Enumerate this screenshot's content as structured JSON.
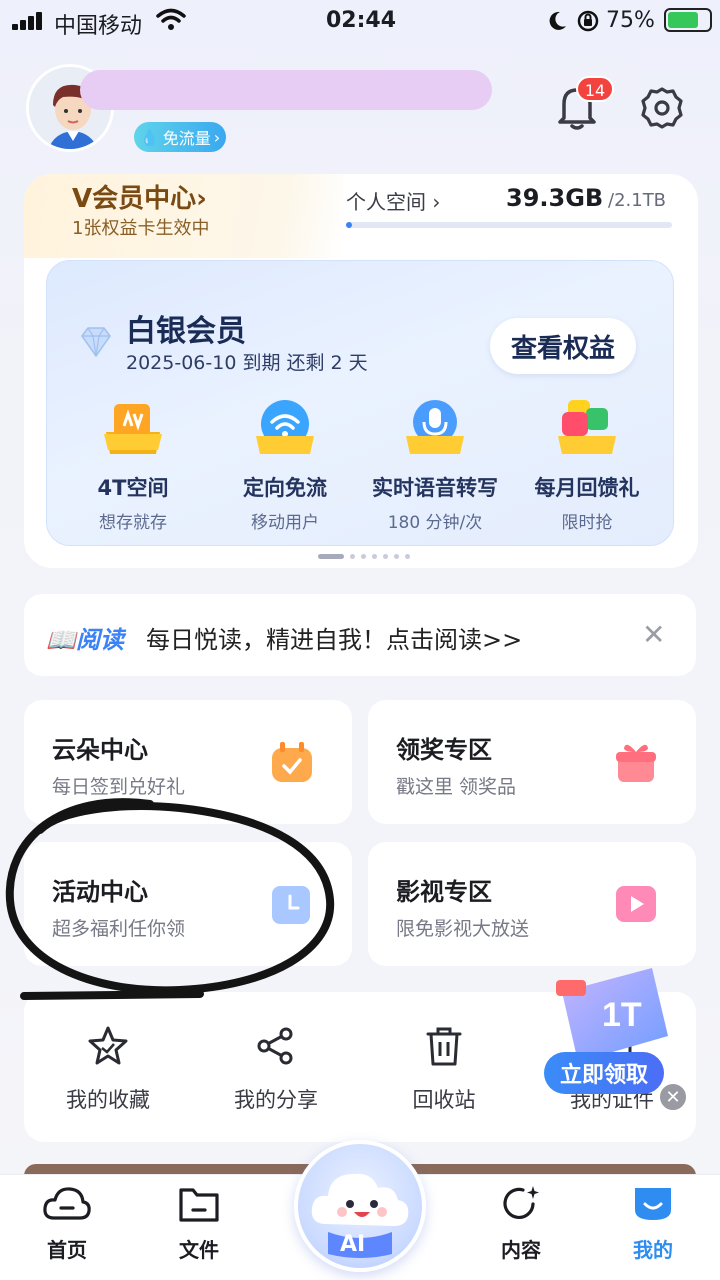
{
  "status_bar": {
    "carrier": "中国移动",
    "time": "02:44",
    "battery_pct": "75%",
    "battery_level": 0.75
  },
  "header": {
    "flow_badge": "免流量",
    "notification_count": "14"
  },
  "vip": {
    "title": "V会员中心",
    "chevron": "›",
    "subtitle": "1张权益卡生效中",
    "space_label": "个人空间",
    "space_used": "39.3GB",
    "space_total": "/2.1TB",
    "space_fraction": 0.018
  },
  "membership": {
    "tier": "白银会员",
    "expiry": "2025-06-10 到期 还剩 2 天",
    "view_button": "查看权益",
    "features": [
      {
        "title": "4T空间",
        "sub": "想存就存",
        "icon": "cloud-folder-icon"
      },
      {
        "title": "定向免流",
        "sub": "移动用户",
        "icon": "wifi-icon"
      },
      {
        "title": "实时语音转写",
        "sub": "180 分钟/次",
        "icon": "microphone-icon"
      },
      {
        "title": "每月回馈礼",
        "sub": "限时抢",
        "icon": "gift-apps-icon"
      }
    ]
  },
  "read_banner": {
    "logo": "阅读",
    "text": "每日悦读，精进自我！点击阅读>>",
    "close": "✕"
  },
  "tiles": [
    {
      "title": "云朵中心",
      "sub": "每日签到兑好礼",
      "icon": "calendar-check-icon",
      "color": "#ff9a3c"
    },
    {
      "title": "领奖专区",
      "sub": "戳这里 领奖品",
      "icon": "gift-icon",
      "color": "#ff7a86"
    },
    {
      "title": "活动中心",
      "sub": "超多福利任你领",
      "icon": "clock-icon",
      "color": "#6aa6ff"
    },
    {
      "title": "影视专区",
      "sub": "限免影视大放送",
      "icon": "film-icon",
      "color": "#ff6fa4"
    }
  ],
  "quick_actions": [
    {
      "label": "我的收藏",
      "icon": "star-icon"
    },
    {
      "label": "我的分享",
      "icon": "share-icon"
    },
    {
      "label": "回收站",
      "icon": "trash-icon"
    },
    {
      "label": "我的证件",
      "icon": "id-card-icon"
    }
  ],
  "promo": {
    "button": "立即领取",
    "badge": "1T",
    "close": "✕"
  },
  "tabbar": {
    "home": "首页",
    "files": "文件",
    "ai": "AI",
    "content": "内容",
    "mine": "我的"
  },
  "colors": {
    "accent": "#2f8cf0",
    "badge_red": "#f3433f",
    "vip_gold": "#7a4a13"
  }
}
